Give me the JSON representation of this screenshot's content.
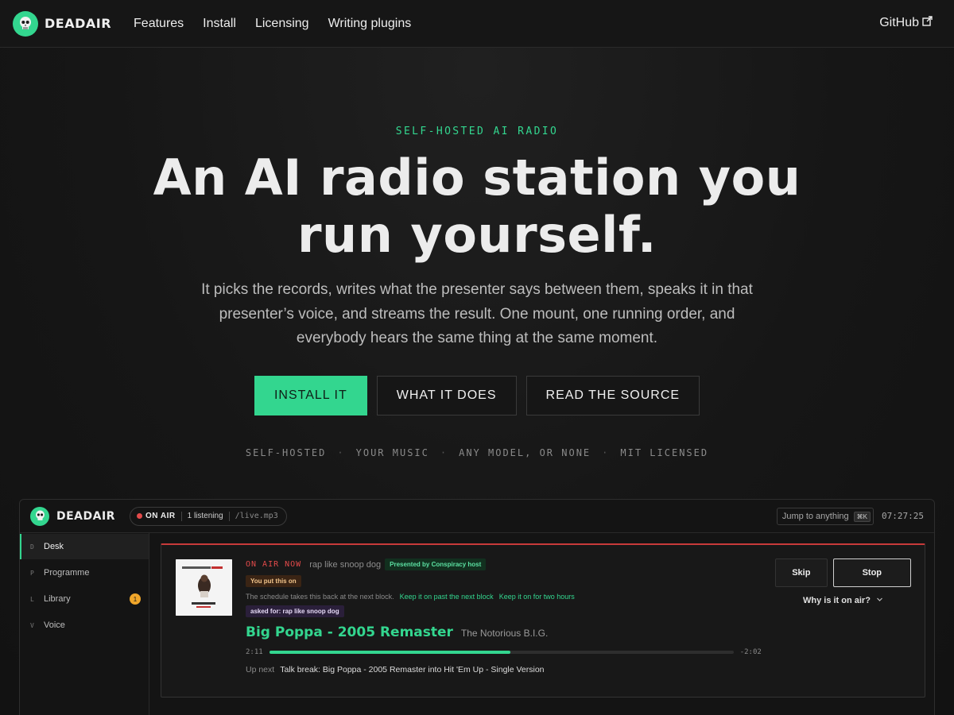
{
  "nav": {
    "brand": "DEADAIR",
    "links": [
      "Features",
      "Install",
      "Licensing",
      "Writing plugins"
    ],
    "github": "GitHub"
  },
  "hero": {
    "eyebrow": "SELF-HOSTED AI RADIO",
    "headline": "An AI radio station you run yourself.",
    "subhead": "It picks the records, writes what the presenter says between them, speaks it in that presenter’s voice, and streams the result. One mount, one running order, and everybody hears the same thing at the same moment.",
    "cta_primary": "INSTALL IT",
    "cta_secondary": "WHAT IT DOES",
    "cta_tertiary": "READ THE SOURCE",
    "tags": [
      "SELF-HOSTED",
      "YOUR MUSIC",
      "ANY MODEL, OR NONE",
      "MIT LICENSED"
    ]
  },
  "app": {
    "brand": "DEADAIR",
    "status": "ON AIR",
    "listeners": "1 listening",
    "mount": "/live.mp3",
    "jump_placeholder": "Jump to anything",
    "jump_shortcut": "⌘K",
    "clock": "07:27:25",
    "sidebar": [
      {
        "key": "D",
        "label": "Desk",
        "active": true
      },
      {
        "key": "P",
        "label": "Programme"
      },
      {
        "key": "L",
        "label": "Library",
        "badge": "1"
      },
      {
        "key": "V",
        "label": "Voice"
      }
    ],
    "now": {
      "on_air_label": "ON AIR NOW",
      "request": "rap like snoop dog",
      "presented_by": "Presented by Conspiracy host",
      "you_put": "You put this on",
      "schedule_note": "The schedule takes this back at the next block.",
      "keep_past": "Keep it on past the next block",
      "keep_two": "Keep it on for two hours",
      "asked_for": "asked for: rap like snoop dog",
      "title": "Big Poppa - 2005 Remaster",
      "artist": "The Notorious B.I.G.",
      "elapsed": "2:11",
      "remaining": "-2:02",
      "progress": 0.52,
      "up_next_label": "Up next",
      "up_next": "Talk break: Big Poppa - 2005 Remaster into Hit 'Em Up - Single Version"
    },
    "controls": {
      "skip": "Skip",
      "stop": "Stop",
      "why": "Why is it on air?"
    }
  },
  "colors": {
    "accent": "#33d68f",
    "on_air_red": "#e24a4a",
    "badge_orange": "#f0a62a"
  }
}
